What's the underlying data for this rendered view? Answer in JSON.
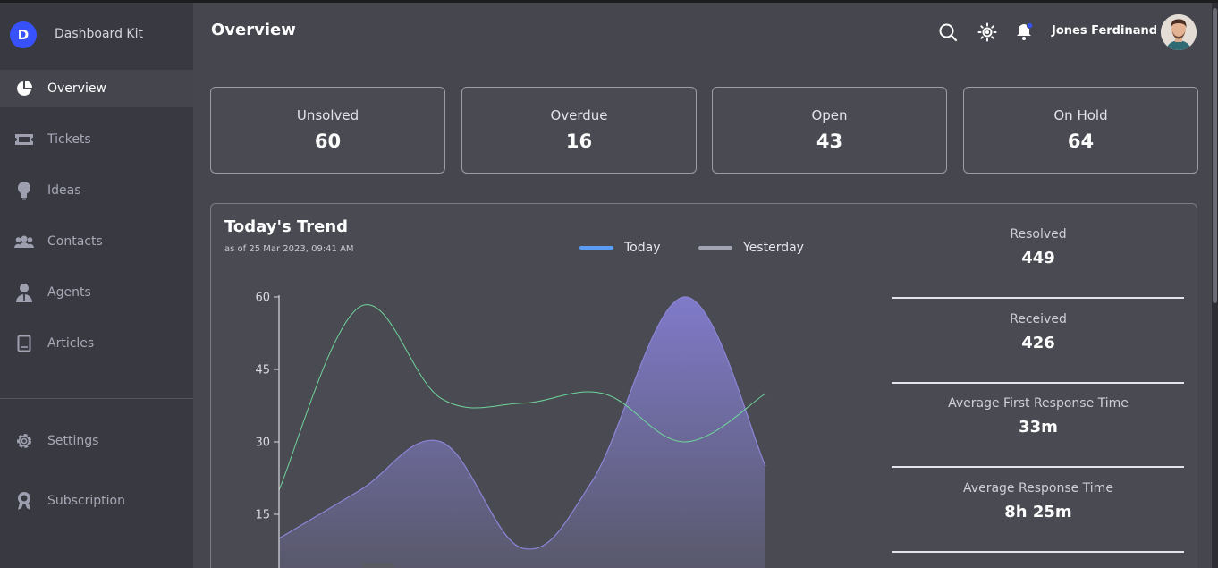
{
  "brand": {
    "logo_letter": "D",
    "name": "Dashboard Kit"
  },
  "sidebar": {
    "items": [
      {
        "label": "Overview",
        "icon": "pie-chart-icon",
        "active": true
      },
      {
        "label": "Tickets",
        "icon": "ticket-icon"
      },
      {
        "label": "Ideas",
        "icon": "lightbulb-icon"
      },
      {
        "label": "Contacts",
        "icon": "contacts-icon"
      },
      {
        "label": "Agents",
        "icon": "agent-icon"
      },
      {
        "label": "Articles",
        "icon": "book-icon"
      }
    ],
    "bottom_items": [
      {
        "label": "Settings",
        "icon": "gear-icon"
      },
      {
        "label": "Subscription",
        "icon": "award-icon"
      }
    ]
  },
  "header": {
    "title": "Overview",
    "icons": [
      "search-icon",
      "theme-toggle-icon",
      "bell-icon"
    ],
    "user_name": "Jones Ferdinand"
  },
  "stats": [
    {
      "label": "Unsolved",
      "value": "60"
    },
    {
      "label": "Overdue",
      "value": "16"
    },
    {
      "label": "Open",
      "value": "43"
    },
    {
      "label": "On Hold",
      "value": "64"
    }
  ],
  "trend": {
    "title": "Today's Trend",
    "subtitle": "as of 25 Mar 2023, 09:41 AM",
    "legend": [
      {
        "name": "Today",
        "color": "#5b9cf5"
      },
      {
        "name": "Yesterday",
        "color": "#a0a4b3"
      }
    ],
    "metrics": [
      {
        "label": "Resolved",
        "value": "449"
      },
      {
        "label": "Received",
        "value": "426"
      },
      {
        "label": "Average First Response Time",
        "value": "33m"
      },
      {
        "label": "Average Response Time",
        "value": "8h 25m"
      }
    ]
  },
  "chart_data": {
    "type": "area",
    "x": [
      0,
      1,
      2,
      3,
      4,
      5,
      6,
      7,
      8
    ],
    "y_ticks": [
      15,
      30,
      45,
      60
    ],
    "ylim": [
      0,
      60
    ],
    "series": [
      {
        "values": [
          10,
          20,
          30,
          8,
          22,
          60,
          25
        ],
        "x": [
          0,
          1.5,
          3,
          4.5,
          5.8,
          7.5,
          9
        ],
        "color": "#8b86d6",
        "fill": true
      },
      {
        "values": [
          20,
          58,
          39,
          38,
          40,
          30,
          40
        ],
        "x": [
          0,
          1.5,
          3,
          4.5,
          6,
          7.5,
          9
        ],
        "color": "#6fd49a",
        "fill": false
      }
    ]
  }
}
